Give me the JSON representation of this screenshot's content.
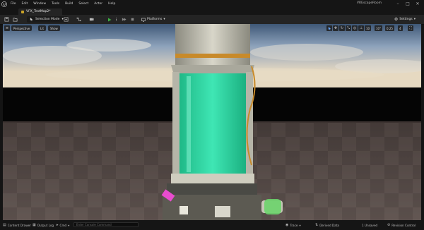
{
  "menubar": {
    "items": [
      "File",
      "Edit",
      "Window",
      "Tools",
      "Build",
      "Select",
      "Actor",
      "Help"
    ],
    "window_title": "VREscapeRoom"
  },
  "tab": {
    "level_name": "VFX_TestMap2*"
  },
  "toolbar": {
    "mode_label": "Selection Mode",
    "platforms_label": "Platforms",
    "settings_label": "Settings"
  },
  "viewport": {
    "perspective_label": "Perspective",
    "lit_label": "Lit",
    "show_label": "Show",
    "grid_snap": "10",
    "rotation_snap": "10°",
    "scale_snap": "0.25",
    "camera_speed": "4"
  },
  "statusbar": {
    "content_drawer": "Content Drawer",
    "output_log": "Output Log",
    "cmd_label": "Cmd",
    "console_placeholder": "Enter Console Command",
    "trace_label": "Trace",
    "derived_data_label": "Derived Data",
    "unsaved_label": "1 Unsaved",
    "revision_control_label": "Revision Control"
  },
  "colors": {
    "liquid": "#2fd9a3",
    "accent_play": "#3cb043",
    "brass": "#c88a2a"
  }
}
